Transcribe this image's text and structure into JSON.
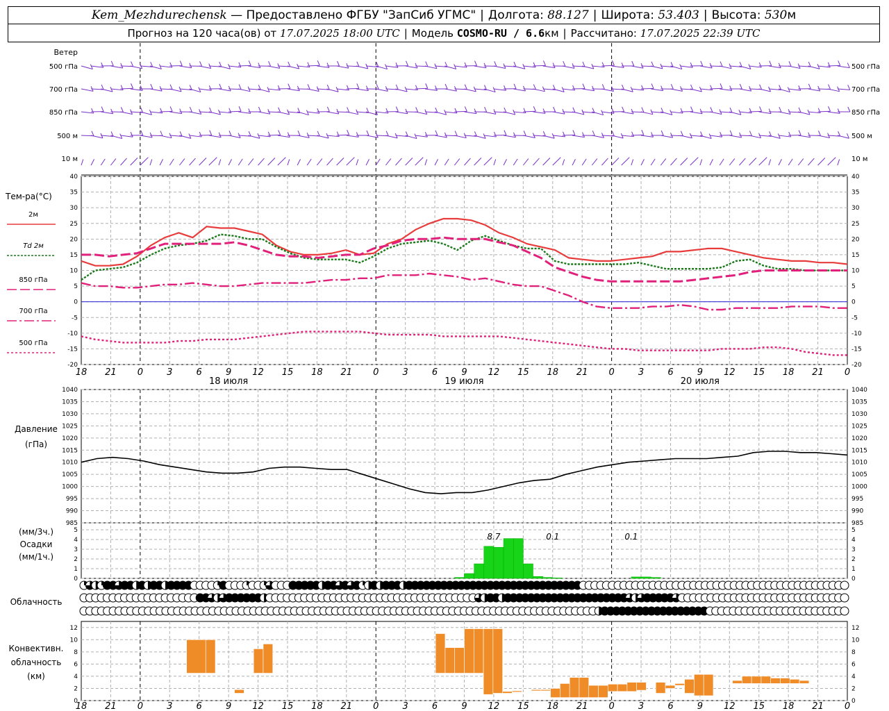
{
  "header": {
    "station": "Kem_Mezhdurechensk",
    "provided": "— Предоставлено ФГБУ \"ЗапСиб УГМС\"",
    "lon_label": "Долгота:",
    "lon": "88.127",
    "lat_label": "Широта:",
    "lat": "53.403",
    "alt_label": "Высота:",
    "alt": "530",
    "alt_unit": "м",
    "forecast_label": "Прогноз на 120 часа(ов) от",
    "forecast_time": "17.07.2025 18:00 UTC",
    "model_label": "Модель",
    "model": "COSMO-RU / 6.6",
    "model_unit": "км",
    "calc_label": "Рассчитано:",
    "calc_time": "17.07.2025 22:39 UTC"
  },
  "labels": {
    "wind": "Ветер",
    "wind_levels": [
      "500 гПа",
      "700 гПа",
      "850 гПа",
      "500 м",
      "10 м"
    ],
    "temp": "Тем-ра(°C)",
    "temp_legend": [
      "2м",
      "Td 2м",
      "850 гПа",
      "700 гПа",
      "500 гПа"
    ],
    "pressure": [
      "Давление",
      "(гПа)"
    ],
    "precip": [
      "(мм/3ч.)",
      "Осадки",
      "(мм/1ч.)"
    ],
    "cloud": "Облачность",
    "conv": [
      "Конвективн.",
      "облачность",
      "(км)"
    ],
    "days": [
      "18 июля",
      "19 июля",
      "20 июля"
    ]
  },
  "colors": {
    "t2m": "#e83c3c",
    "td": "#1a7a1a",
    "t850": "#e0207a",
    "t700": "#e0207a",
    "t500": "#e0207a",
    "wind": "#7a30c8",
    "precip": "#18d418",
    "conv": "#f08c28",
    "zero": "#2020d0"
  },
  "chart_data": [
    {
      "type": "line",
      "name": "temperature",
      "ylim": [
        -20,
        40
      ],
      "x_ticks": [
        "18",
        "21",
        "0",
        "3",
        "6",
        "9",
        "12",
        "15",
        "18",
        "21",
        "0",
        "3",
        "6",
        "9",
        "12",
        "15",
        "18",
        "21",
        "0",
        "3",
        "6",
        "9",
        "12",
        "15",
        "18",
        "21",
        "0"
      ],
      "series": [
        {
          "name": "2м",
          "values": [
            13,
            11.5,
            11.5,
            12,
            14.5,
            18,
            20.5,
            22,
            20.5,
            24,
            23.5,
            23.5,
            22.5,
            21.5,
            18,
            16,
            15,
            15,
            15.5,
            16.5,
            15,
            15.5,
            18.5,
            20,
            23,
            25,
            26.5,
            26.5,
            26,
            24.5,
            22,
            20.5,
            18.5,
            17.5,
            16.5,
            14,
            13.5,
            13,
            13,
            13.5,
            14,
            14.5,
            16,
            16,
            16.5,
            17,
            17,
            16,
            15,
            14,
            13.5,
            13,
            13,
            12.5,
            12.5,
            12
          ]
        },
        {
          "name": "Td 2м",
          "values": [
            7,
            10,
            10.5,
            11,
            12.5,
            15,
            17,
            18,
            18.5,
            19.5,
            21.5,
            21,
            20,
            20,
            17.5,
            15.5,
            14,
            13.5,
            13.5,
            13.5,
            12.5,
            14.5,
            17,
            18.5,
            19,
            19.5,
            18.5,
            16.5,
            19.5,
            21,
            19.5,
            18,
            17,
            17,
            13,
            12,
            12,
            12,
            12,
            12,
            12.5,
            11.5,
            10.5,
            10.5,
            10.5,
            10.5,
            11,
            13,
            13.5,
            11.5,
            10.5,
            10.5,
            10,
            10,
            10,
            10
          ]
        },
        {
          "name": "850 гПа",
          "values": [
            15,
            15,
            14.5,
            15,
            15.5,
            17,
            18.5,
            18.5,
            18.5,
            18.5,
            18.5,
            19,
            18,
            16.5,
            15,
            14.5,
            14.5,
            14,
            14.5,
            15,
            15,
            17,
            18,
            19.5,
            20,
            20,
            20.5,
            20,
            20,
            20,
            19,
            18,
            16,
            14,
            11,
            9.5,
            8,
            7,
            6.5,
            6.5,
            6.5,
            6.5,
            6.5,
            6.5,
            7,
            7.5,
            8,
            8.5,
            9.5,
            10,
            10,
            10,
            10,
            10,
            10,
            10
          ]
        },
        {
          "name": "700 гПа",
          "values": [
            6,
            5,
            5,
            4.5,
            4.5,
            5,
            5.5,
            5.5,
            6,
            5.5,
            5,
            5,
            5.5,
            6,
            6,
            6,
            6,
            6.5,
            7,
            7,
            7.5,
            7.5,
            8.5,
            8.5,
            8.5,
            9,
            8.5,
            8,
            7,
            7.5,
            6.5,
            5.5,
            5,
            5,
            3.5,
            2,
            0,
            -1.5,
            -2,
            -2,
            -2,
            -1.5,
            -1.5,
            -1,
            -1.5,
            -2.5,
            -2.5,
            -2,
            -2,
            -2,
            -2,
            -1.5,
            -1.5,
            -1.5,
            -2,
            -2
          ]
        },
        {
          "name": "500 гПа",
          "values": [
            -11,
            -12,
            -12.5,
            -13,
            -13,
            -13,
            -13,
            -12.5,
            -12.5,
            -12,
            -12,
            -12,
            -11.5,
            -11,
            -10.5,
            -10,
            -9.5,
            -9.5,
            -9.5,
            -9.5,
            -9.5,
            -10,
            -10.5,
            -10.5,
            -10.5,
            -10.5,
            -11,
            -11,
            -11,
            -11,
            -11,
            -11.5,
            -12,
            -12.5,
            -13,
            -13.5,
            -14,
            -14.5,
            -15,
            -15,
            -15.5,
            -15.5,
            -15.5,
            -15.5,
            -15.5,
            -15.5,
            -15,
            -15,
            -15,
            -14.5,
            -14.5,
            -15,
            -16,
            -16.5,
            -17,
            -17
          ]
        }
      ]
    },
    {
      "type": "line",
      "name": "pressure",
      "ylim": [
        985,
        1040
      ],
      "series": [
        {
          "name": "Давление",
          "values": [
            1010,
            1011.5,
            1012,
            1011.5,
            1010.5,
            1009,
            1008,
            1007,
            1006,
            1005.5,
            1005.5,
            1006,
            1007.5,
            1008,
            1008,
            1007.5,
            1007,
            1007,
            1005,
            1003,
            1001,
            999,
            997.5,
            997,
            997.5,
            997.5,
            998.5,
            1000,
            1001.5,
            1002.5,
            1003,
            1005,
            1006.5,
            1008,
            1009,
            1010,
            1010.5,
            1011,
            1011.5,
            1011.5,
            1011.5,
            1012,
            1012.5,
            1014,
            1014.5,
            1014.5,
            1014,
            1014,
            1013.5,
            1013
          ]
        }
      ]
    },
    {
      "type": "bar",
      "name": "precipitation",
      "ylim": [
        0,
        5
      ],
      "series": [
        {
          "name": "Осадки 1ч",
          "hours": [
            38,
            39,
            40,
            41,
            42,
            43,
            44,
            45,
            46,
            47,
            48,
            56,
            57,
            58
          ],
          "values": [
            0.1,
            0.5,
            1.5,
            3.3,
            3.2,
            4.1,
            4.1,
            1.5,
            0.2,
            0.1,
            0.05,
            0.15,
            0.15,
            0.1
          ]
        }
      ],
      "labels": [
        {
          "hour": 42,
          "text": "8.7"
        },
        {
          "hour": 48,
          "text": "0.1"
        },
        {
          "hour": 56,
          "text": "0.1"
        }
      ]
    },
    {
      "type": "bar",
      "name": "convective_cloud",
      "ylim": [
        0,
        12
      ],
      "series": [
        {
          "name": "Конвективная облачность",
          "bars": [
            [
              33,
              39,
              4.5,
              10
            ],
            [
              39,
              42,
              4.5,
              10
            ],
            [
              48,
              51,
              1.2,
              1.8
            ],
            [
              54,
              57,
              4.5,
              8.5
            ],
            [
              57,
              60,
              4.5,
              9.3
            ],
            [
              111,
              114,
              4.5,
              11
            ],
            [
              114,
              117,
              4.5,
              8.7
            ],
            [
              117,
              120,
              4.5,
              8.7
            ],
            [
              120,
              123,
              4.5,
              11.8
            ],
            [
              123,
              126,
              4.5,
              11.8
            ],
            [
              126,
              129,
              1.0,
              11.8
            ],
            [
              129,
              132,
              1.2,
              11.8
            ],
            [
              132,
              135,
              1.2,
              1.5
            ],
            [
              135,
              138,
              1.4,
              1.6
            ],
            [
              141,
              144,
              1.6,
              1.8
            ],
            [
              144,
              147,
              1.6,
              1.8
            ],
            [
              147,
              150,
              0.5,
              2
            ],
            [
              150,
              153,
              0.5,
              2.8
            ],
            [
              153,
              156,
              0.5,
              3.8
            ],
            [
              156,
              159,
              0.5,
              3.8
            ],
            [
              159,
              162,
              0.5,
              2.5
            ],
            [
              162,
              165,
              0.5,
              2.5
            ],
            [
              165,
              168,
              1.5,
              2.7
            ],
            [
              168,
              171,
              1.5,
              2.7
            ],
            [
              171,
              174,
              1.5,
              3.0
            ],
            [
              174,
              177,
              1.7,
              3.0
            ],
            [
              180,
              183,
              1.2,
              3.0
            ],
            [
              183,
              186,
              2.0,
              2.5
            ],
            [
              186,
              189,
              2.5,
              2.8
            ],
            [
              189,
              192,
              1.2,
              3.5
            ],
            [
              192,
              195,
              0.8,
              4.3
            ],
            [
              195,
              198,
              0.8,
              4.3
            ],
            [
              204,
              207,
              2.8,
              3.3
            ],
            [
              207,
              210,
              2.8,
              4.0
            ],
            [
              210,
              213,
              2.8,
              4.0
            ],
            [
              213,
              216,
              2.8,
              4.0
            ],
            [
              216,
              219,
              2.8,
              3.7
            ],
            [
              219,
              222,
              2.8,
              3.7
            ],
            [
              222,
              225,
              2.8,
              3.5
            ],
            [
              225,
              228,
              2.8,
              3.3
            ]
          ]
        }
      ]
    }
  ],
  "cloud_rows": [
    [
      1,
      3,
      2,
      1,
      4,
      4,
      3,
      4,
      4,
      2,
      4,
      2,
      4,
      4,
      2,
      4,
      4,
      4,
      4,
      0,
      0,
      0,
      0,
      1,
      4,
      0,
      0,
      0,
      1,
      0,
      0,
      1,
      3,
      0,
      0,
      0,
      4,
      4,
      4,
      4,
      4,
      2,
      4,
      4,
      3,
      4,
      3,
      4,
      1,
      2,
      4,
      2,
      4,
      4,
      4,
      2,
      4,
      4,
      4,
      4,
      4,
      4,
      4,
      4,
      4,
      4,
      4,
      4,
      4,
      4,
      4,
      4,
      4,
      4,
      4,
      4,
      4,
      4,
      4,
      4,
      4,
      4,
      4,
      4,
      4,
      4,
      0,
      0,
      0,
      0,
      0,
      0,
      0,
      0,
      0,
      0,
      0,
      0,
      0,
      0,
      0,
      0,
      0,
      0,
      0,
      0,
      0,
      0,
      0,
      0,
      0,
      0,
      0,
      0,
      0,
      0,
      0,
      0,
      0,
      0,
      0,
      0,
      0,
      0,
      0,
      0,
      0,
      0,
      0,
      0,
      0,
      0
    ],
    [
      0,
      0,
      0,
      0,
      0,
      0,
      0,
      0,
      0,
      0,
      0,
      0,
      0,
      0,
      0,
      0,
      0,
      0,
      0,
      0,
      4,
      4,
      3,
      2,
      3,
      4,
      4,
      4,
      4,
      4,
      4,
      2,
      0,
      0,
      0,
      0,
      0,
      0,
      0,
      0,
      0,
      0,
      0,
      0,
      0,
      0,
      0,
      0,
      0,
      0,
      0,
      0,
      0,
      0,
      0,
      0,
      0,
      0,
      0,
      0,
      0,
      0,
      0,
      0,
      0,
      0,
      0,
      0,
      3,
      2,
      4,
      4,
      2,
      4,
      4,
      4,
      4,
      4,
      4,
      4,
      4,
      4,
      4,
      4,
      4,
      4,
      4,
      4,
      4,
      4,
      4,
      4,
      4,
      4,
      3,
      2,
      3,
      4,
      4,
      4,
      4,
      4,
      3,
      0,
      0,
      0,
      0,
      0,
      0,
      0,
      0,
      0,
      0,
      0,
      0,
      0,
      0,
      0,
      0,
      0,
      0,
      0,
      0,
      0,
      0,
      0,
      0,
      0,
      0,
      0,
      0,
      0
    ],
    [
      0,
      0,
      0,
      0,
      0,
      0,
      0,
      0,
      0,
      0,
      0,
      0,
      0,
      0,
      0,
      0,
      0,
      0,
      0,
      0,
      0,
      0,
      0,
      0,
      0,
      0,
      0,
      0,
      0,
      0,
      0,
      0,
      0,
      0,
      0,
      0,
      0,
      0,
      0,
      0,
      0,
      0,
      0,
      0,
      0,
      0,
      0,
      0,
      0,
      0,
      0,
      0,
      0,
      0,
      0,
      0,
      0,
      0,
      0,
      0,
      0,
      0,
      0,
      0,
      0,
      0,
      0,
      0,
      0,
      0,
      0,
      0,
      0,
      0,
      0,
      0,
      0,
      0,
      0,
      0,
      0,
      0,
      0,
      0,
      0,
      0,
      0,
      0,
      2,
      4,
      4,
      4,
      4,
      4,
      4,
      4,
      4,
      4,
      4,
      4,
      4,
      4,
      4,
      4,
      4,
      4,
      4,
      0,
      0,
      0,
      0,
      0,
      0,
      0,
      0,
      0,
      0,
      0,
      0,
      0,
      0,
      0,
      0,
      0,
      0,
      0,
      0,
      0,
      0,
      0,
      0
    ]
  ]
}
